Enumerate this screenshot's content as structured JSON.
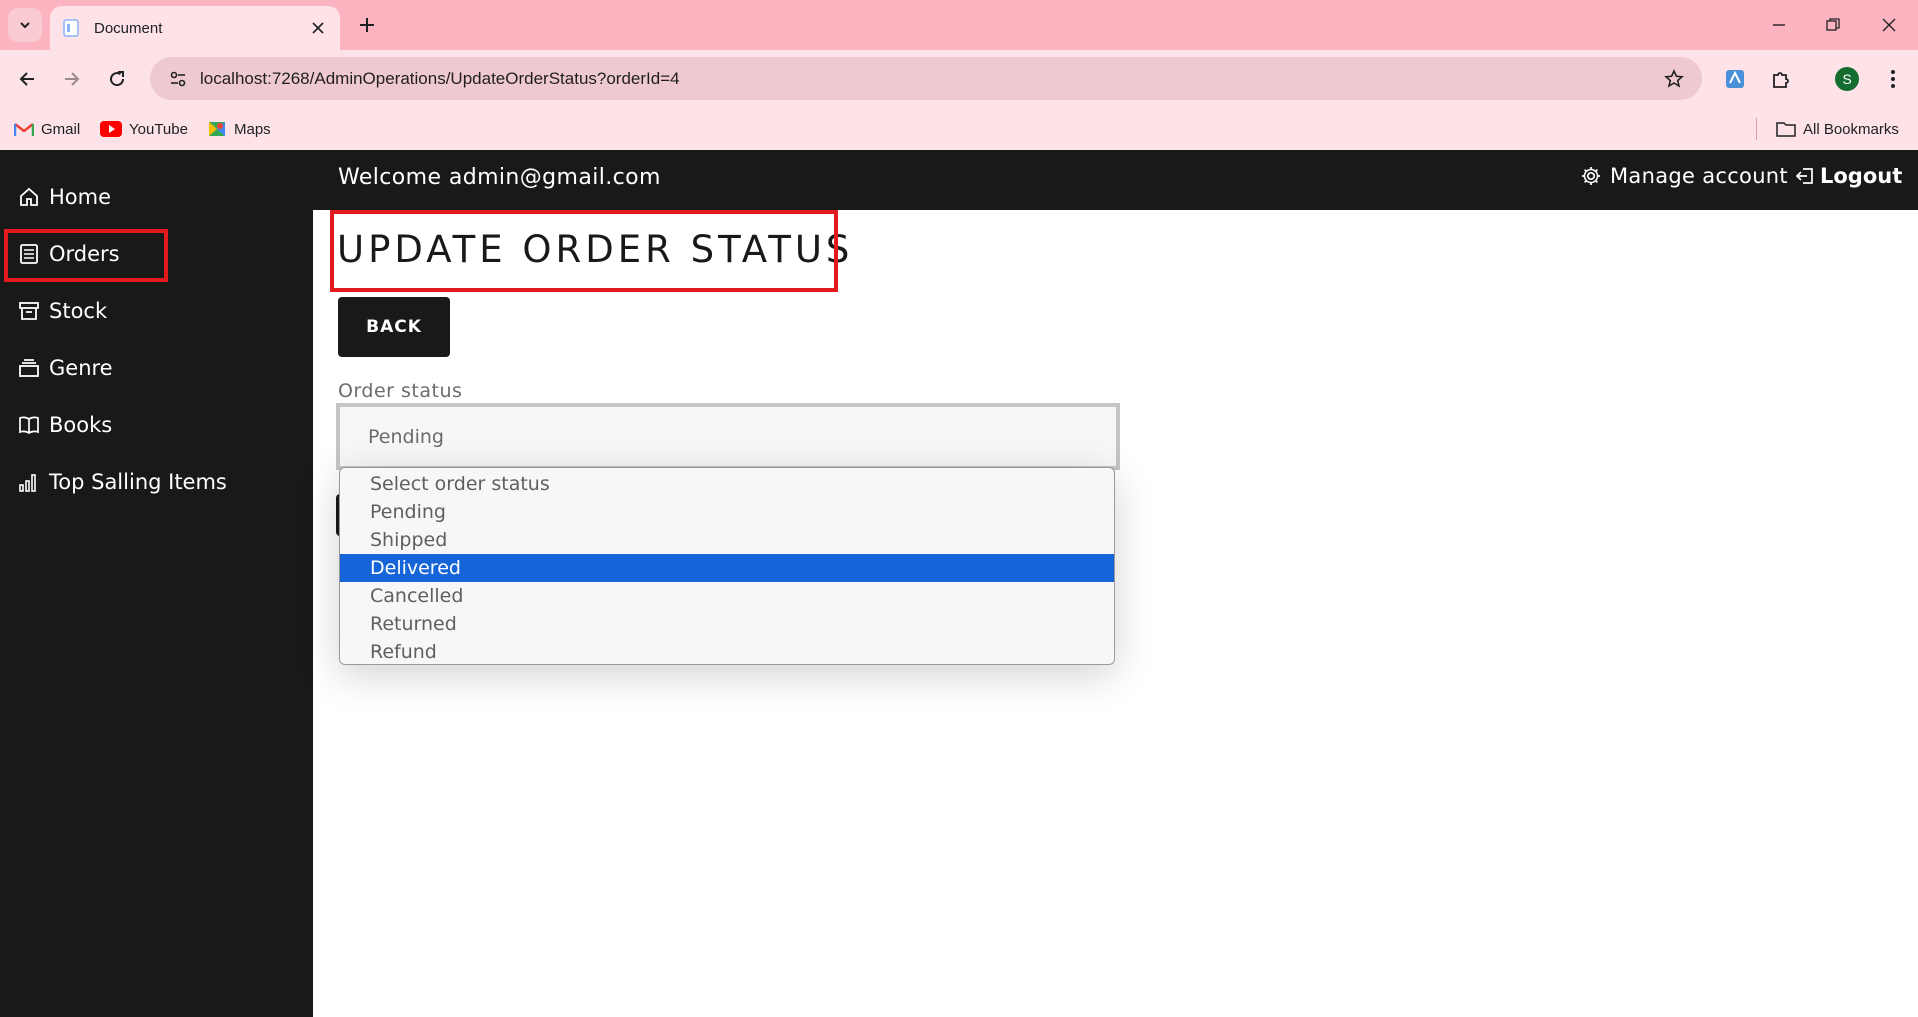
{
  "browser": {
    "tab_title": "Document",
    "url": "localhost:7268/AdminOperations/UpdateOrderStatus?orderId=4",
    "profile_initial": "S",
    "bookmarks": [
      {
        "label": "Gmail",
        "icon": "gmail-icon"
      },
      {
        "label": "YouTube",
        "icon": "youtube-icon"
      },
      {
        "label": "Maps",
        "icon": "maps-icon"
      }
    ],
    "all_bookmarks_label": "All Bookmarks"
  },
  "sidebar": {
    "items": [
      {
        "label": "Home",
        "icon": "home-icon"
      },
      {
        "label": "Orders",
        "icon": "orders-icon"
      },
      {
        "label": "Stock",
        "icon": "archive-icon"
      },
      {
        "label": "Genre",
        "icon": "stack-icon"
      },
      {
        "label": "Books",
        "icon": "book-icon"
      },
      {
        "label": "Top Salling Items",
        "icon": "bar-chart-icon"
      }
    ],
    "active_item": "Orders"
  },
  "header": {
    "welcome": "Welcome admin@gmail.com",
    "manage_account": "Manage account",
    "logout": "Logout"
  },
  "main": {
    "title": "UPDATE ORDER STATUS",
    "back_label": "BACK",
    "order_status_label": "Order status",
    "order_status_value": "Pending",
    "order_status_options": [
      "Select order status",
      "Pending",
      "Shipped",
      "Delivered",
      "Cancelled",
      "Returned",
      "Refund"
    ],
    "highlighted_option": "Delivered"
  },
  "colors": {
    "tabstrip": "#fdb4c1",
    "toolbar": "#fde3e8",
    "sidebar_bg": "#191919",
    "highlight_box": "#e3191e",
    "selected_option": "#1565d8"
  }
}
